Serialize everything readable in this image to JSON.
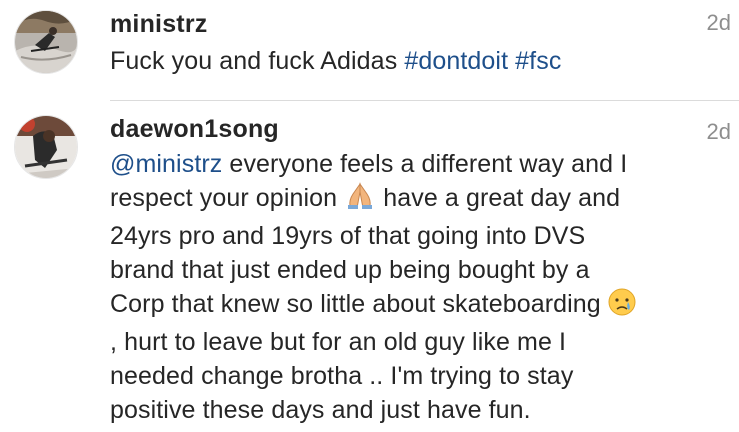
{
  "comments": [
    {
      "username": "ministrz",
      "time": "2d",
      "text_plain": "Fuck you and fuck Adidas ",
      "hashtag1": "#dontdoit",
      "hashtag2": "#fsc",
      "avatar": "skateboarder-avatar"
    },
    {
      "username": "daewon1song",
      "time": "2d",
      "mention": "@ministrz",
      "line1_rest": " everyone feels a different way and I",
      "line2a": "respect your opinion ",
      "emoji1": "folded-hands-emoji",
      "line2b": " have a great day and",
      "line3": "24yrs pro and 19yrs of that going into DVS",
      "line4": "brand that just ended up being bought by a",
      "line5": "Corp that knew so little about skateboarding ",
      "emoji2": "crying-face-emoji",
      "line6": ", hurt to leave but for an old guy like me I",
      "line7": "needed change brotha .. I'm trying to stay",
      "line8": "positive these days and just have fun.",
      "avatar": "skater-avatar"
    }
  ],
  "colors": {
    "link": "#1e4f8a",
    "text": "#262626",
    "time": "#8e8e8e",
    "divider": "#dbdbdb"
  }
}
